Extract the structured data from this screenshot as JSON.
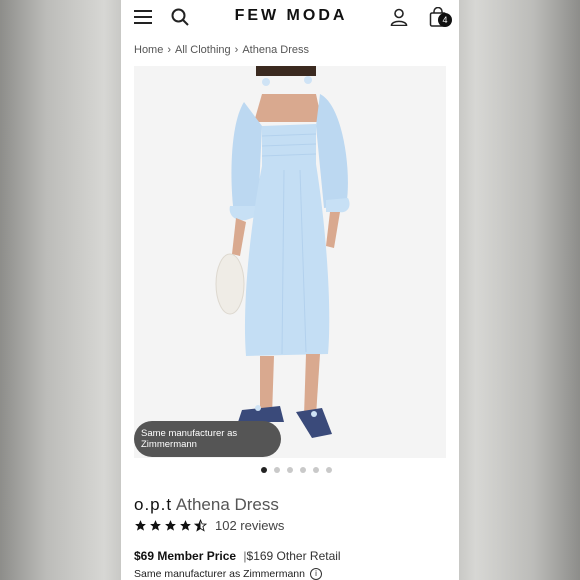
{
  "header": {
    "logo": "FEW MODA",
    "cart_count": "4",
    "icons": [
      "hamburger-menu-icon",
      "search-icon",
      "user-icon",
      "shopping-bag-icon"
    ]
  },
  "breadcrumb": {
    "items": [
      "Home",
      "All Clothing",
      "Athena Dress"
    ]
  },
  "image": {
    "toast": "Same manufacturer as Zimmermann",
    "carousel_count": 6,
    "active_index": 0
  },
  "product": {
    "brand": "o.p.t",
    "name": "Athena Dress",
    "rating": 4.5,
    "reviews": "102 reviews",
    "member_price": "$69 Member Price",
    "separator": "|",
    "retail_price": "$169 Other Retail",
    "manufacturer_note": "Same manufacturer as Zimmermann"
  },
  "colors": {
    "dress": "#c4def4",
    "text": "#222222",
    "toast": "#555555"
  }
}
